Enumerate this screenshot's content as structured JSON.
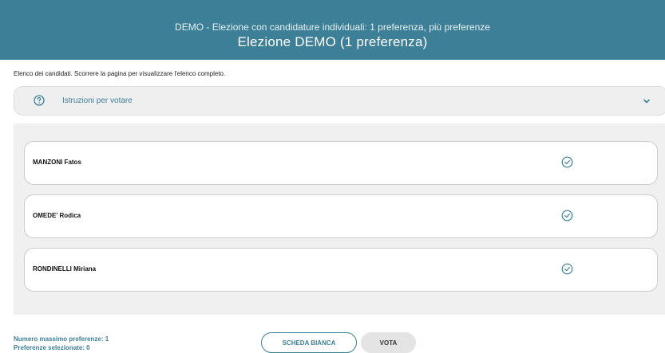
{
  "header": {
    "subtitle": "DEMO - Elezione con candidature individuali: 1 preferenza, più preferenze",
    "title": "Elezione DEMO (1 preferenza)"
  },
  "intro_text": "Elenco dei candidati. Scorrere la pagina per visualizzare l'elenco completo.",
  "instructions": {
    "label": "Istruzioni per votare",
    "icon": "help-circle-icon",
    "toggle_icon": "chevron-down-icon"
  },
  "candidates": [
    {
      "name": "MANZONI Fatos",
      "icon": "check-circle-icon"
    },
    {
      "name": "OMEDE' Rodica",
      "icon": "check-circle-icon"
    },
    {
      "name": "RONDINELLI Miriana",
      "icon": "check-circle-icon"
    }
  ],
  "footer": {
    "max_preferences": "Numero massimo preferenze: 1",
    "selected_preferences": "Preferenze selezionate: 0"
  },
  "buttons": {
    "blank_ballot": "SCHEDA BIANCA",
    "vote": "VOTA"
  },
  "colors": {
    "accent": "#3d7f96",
    "panel_bg": "#f0f0f0"
  }
}
